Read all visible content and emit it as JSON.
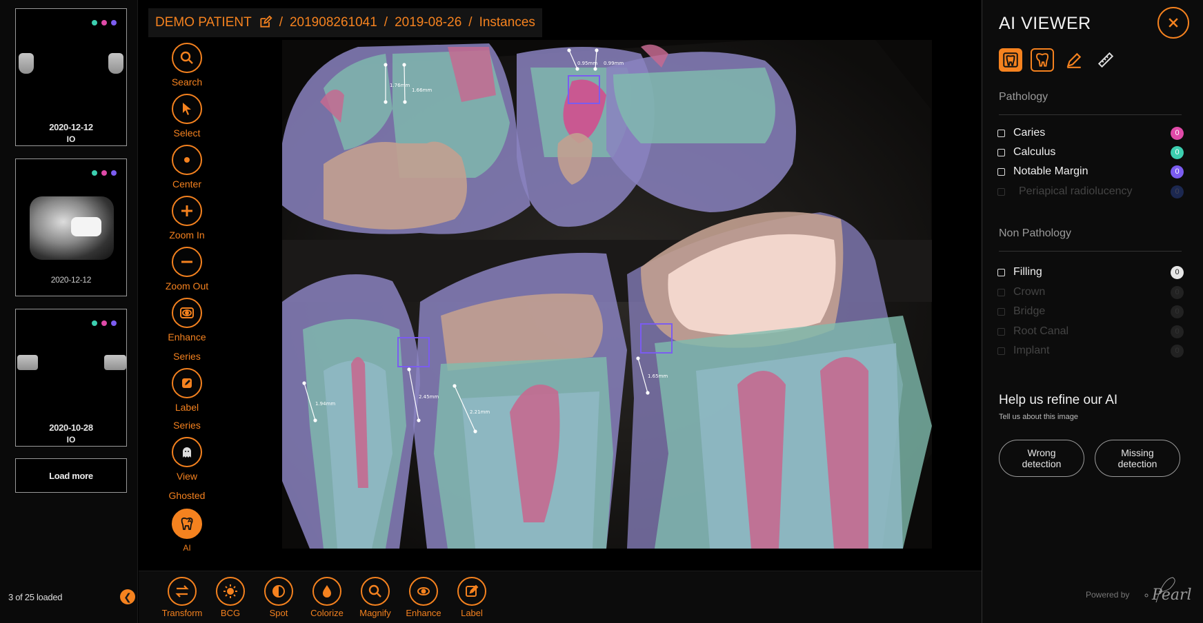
{
  "thumbnails": [
    {
      "date": "2020-12-12",
      "sub": "IO"
    },
    {
      "date": "2020-12-12",
      "sub": ""
    },
    {
      "date": "2020-10-28",
      "sub": "IO"
    }
  ],
  "status_dots": [
    "#3ccfb0",
    "#e04aa8",
    "#7b5cf0"
  ],
  "load_more": "Load more",
  "loaded_count": "3 of 25 loaded",
  "breadcrumb": {
    "patient": "DEMO PATIENT",
    "sep": "/",
    "study": "201908261041",
    "date": "2019-08-26",
    "section": "Instances"
  },
  "tools": {
    "search": "Search",
    "select": "Select",
    "center": "Center",
    "zoom_in": "Zoom In",
    "zoom_out": "Zoom Out",
    "enhance": "Enhance",
    "enhance_sub": "Series",
    "label": "Label",
    "label_sub": "Series",
    "view": "View",
    "view_sub": "Ghosted",
    "ai": "AI",
    "ai_icon_text": "AI"
  },
  "measurements": [
    "1.76mm",
    "1.66mm",
    "0.95mm",
    "0.99mm",
    "1.94mm",
    "2.45mm",
    "2.21mm",
    "1.65mm"
  ],
  "bottom_tools": [
    "Transform",
    "BCG",
    "Spot",
    "Colorize",
    "Magnify",
    "Enhance",
    "Label"
  ],
  "ai_panel": {
    "title": "AI VIEWER",
    "pathology_title": "Pathology",
    "pathology": [
      {
        "name": "Caries",
        "count": "0",
        "color": "#e04aa8",
        "enabled": true
      },
      {
        "name": "Calculus",
        "count": "0",
        "color": "#3ccfb0",
        "enabled": true
      },
      {
        "name": "Notable Margin",
        "count": "0",
        "color": "#7b5cf0",
        "enabled": true
      },
      {
        "name": "Periapical radiolucency",
        "count": "0",
        "color": "#2a3a6a",
        "enabled": false
      }
    ],
    "non_pathology_title": "Non Pathology",
    "non_pathology": [
      {
        "name": "Filling",
        "count": "0",
        "color": "#e6e6e6",
        "enabled": true
      },
      {
        "name": "Crown",
        "count": "0",
        "color": "#333333",
        "enabled": false
      },
      {
        "name": "Bridge",
        "count": "0",
        "color": "#333333",
        "enabled": false
      },
      {
        "name": "Root Canal",
        "count": "0",
        "color": "#333333",
        "enabled": false
      },
      {
        "name": "Implant",
        "count": "0",
        "color": "#333333",
        "enabled": false
      }
    ],
    "help_title": "Help us refine our AI",
    "help_sub": "Tell us about this image",
    "wrong_detection": "Wrong detection",
    "missing_detection": "Missing detection",
    "powered_by": "Powered by",
    "brand": "Pearl"
  },
  "colors": {
    "accent": "#f5821f"
  }
}
